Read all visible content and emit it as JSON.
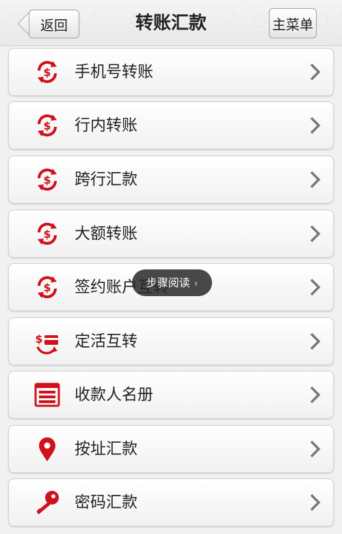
{
  "header": {
    "back_label": "返回",
    "title": "转账汇款",
    "menu_label": "主菜单"
  },
  "items": [
    {
      "label": "手机号转账",
      "icon": "money-transfer-icon"
    },
    {
      "label": "行内转账",
      "icon": "money-transfer-icon"
    },
    {
      "label": "跨行汇款",
      "icon": "money-transfer-icon"
    },
    {
      "label": "大额转账",
      "icon": "money-transfer-icon"
    },
    {
      "label": "签约账户互转",
      "icon": "money-transfer-icon"
    },
    {
      "label": "定活互转",
      "icon": "card-exchange-icon"
    },
    {
      "label": "收款人名册",
      "icon": "payee-list-icon"
    },
    {
      "label": "按址汇款",
      "icon": "location-pin-icon"
    },
    {
      "label": "密码汇款",
      "icon": "key-icon"
    }
  ],
  "toast": {
    "label": "步骤阅读"
  },
  "colors": {
    "icon_red": "#d0111b",
    "text": "#222222"
  }
}
